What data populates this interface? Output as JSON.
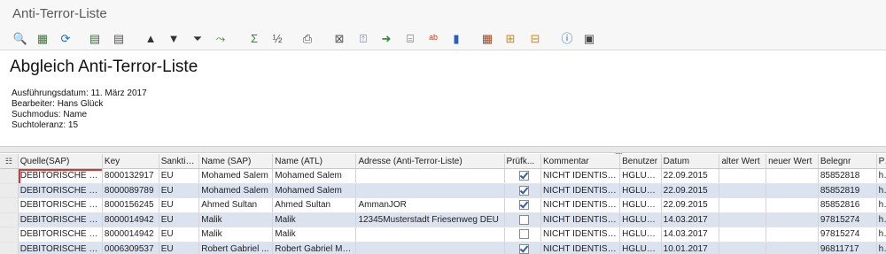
{
  "window": {
    "title": "Anti-Terror-Liste"
  },
  "toolbar": {
    "buttons": [
      {
        "icon": "detail-icon",
        "glyph": "🔍",
        "color": "#2a6e9e"
      },
      {
        "icon": "calculator-icon",
        "glyph": "▦",
        "color": "#3a7a3a"
      },
      {
        "icon": "refresh-icon",
        "glyph": "⟳",
        "color": "#1c6fb3"
      },
      {
        "icon": "select-layout-icon",
        "glyph": "▤",
        "color": "#2b7a2b"
      },
      {
        "icon": "layout-details-icon",
        "glyph": "▤",
        "color": "#555555"
      },
      {
        "icon": "sort-ascending-icon",
        "glyph": "▲",
        "color": "#333333"
      },
      {
        "icon": "sort-descending-icon",
        "glyph": "▼",
        "color": "#333333"
      },
      {
        "icon": "filter-icon",
        "glyph": "⏷",
        "color": "#333333"
      },
      {
        "icon": "delete-filter-icon",
        "glyph": "⤳",
        "color": "#2a7a2a"
      },
      {
        "icon": "sum-icon",
        "glyph": "Σ",
        "color": "#2b8a2b"
      },
      {
        "icon": "subtotal-icon",
        "glyph": "½",
        "color": "#555555"
      },
      {
        "icon": "print-icon",
        "glyph": "⎙",
        "color": "#444444"
      },
      {
        "icon": "view-icon",
        "glyph": "⊠",
        "color": "#555555"
      },
      {
        "icon": "export-icon",
        "glyph": "⍐",
        "color": "#2a5fb3"
      },
      {
        "icon": "send-icon",
        "glyph": "➜",
        "color": "#2b8a2b"
      },
      {
        "icon": "column-icon",
        "glyph": "⌸",
        "color": "#444444"
      },
      {
        "icon": "abc-icon",
        "glyph": "ᵃᵇ",
        "color": "#c04020"
      },
      {
        "icon": "graphic-icon",
        "glyph": "▮",
        "color": "#2a5fb3"
      },
      {
        "icon": "layout-icon",
        "glyph": "▦",
        "color": "#b04010"
      },
      {
        "icon": "choose-layout-icon",
        "glyph": "⊞",
        "color": "#d08a10"
      },
      {
        "icon": "save-layout-icon",
        "glyph": "⊟",
        "color": "#d08a10"
      },
      {
        "icon": "info-icon",
        "glyph": "ⓘ",
        "color": "#2a5fb3"
      },
      {
        "icon": "save-icon",
        "glyph": "▣",
        "color": "#444444"
      }
    ]
  },
  "report": {
    "title": "Abgleich Anti-Terror-Liste",
    "meta": [
      "Ausführungsdatum: 11. März 2017",
      "Bearbeiter: Hans Glück",
      "Suchmodus: Name",
      "Suchtoleranz: 15"
    ]
  },
  "table": {
    "columns": [
      "Quelle(SAP)",
      "Key",
      "Sanktio...",
      "Name (SAP)",
      "Name (ATL)",
      "Adresse (Anti-Terror-Liste)",
      "Prüfk...",
      "Kommentar",
      "Benutzer",
      "Datum",
      "alter Wert",
      "neuer Wert",
      "Belegnr",
      "PDF"
    ],
    "rows": [
      {
        "quelle": "DEBITORISCHE GP",
        "key": "8000132917",
        "sank": "EU",
        "name_sap": "Mohamed Salem",
        "name_atl": "Mohamed Salem",
        "adresse": "",
        "checked": true,
        "kommentar": "NICHT IDENTISCH",
        "benutzer": "HGLUECK",
        "datum": "22.09.2015",
        "alt": "",
        "neu": "",
        "belegnr": "85852818",
        "pdf": "http"
      },
      {
        "quelle": "DEBITORISCHE GP",
        "key": "8000089789",
        "sank": "EU",
        "name_sap": "Mohamed Salem",
        "name_atl": "Mohamed Salem",
        "adresse": "",
        "checked": true,
        "kommentar": "NICHT IDENTISCH",
        "benutzer": "HGLUECK",
        "datum": "22.09.2015",
        "alt": "",
        "neu": "",
        "belegnr": "85852819",
        "pdf": "http"
      },
      {
        "quelle": "DEBITORISCHE GP",
        "key": "8000156245",
        "sank": "EU",
        "name_sap": "Ahmed Sultan",
        "name_atl": "Ahmed Sultan",
        "adresse": "AmmanJOR",
        "checked": true,
        "kommentar": "NICHT IDENTISCH",
        "benutzer": "HGLUECK",
        "datum": "22.09.2015",
        "alt": "",
        "neu": "",
        "belegnr": "85852816",
        "pdf": "http"
      },
      {
        "quelle": "DEBITORISCHE GP",
        "key": "8000014942",
        "sank": "EU",
        "name_sap": "Malik",
        "name_atl": "Malik",
        "adresse": "12345Musterstadt Friesenweg DEU",
        "checked": false,
        "kommentar": "NICHT IDENTISCH",
        "benutzer": "HGLUECK",
        "datum": "14.03.2017",
        "alt": "",
        "neu": "",
        "belegnr": "97815274",
        "pdf": "http"
      },
      {
        "quelle": "DEBITORISCHE GP",
        "key": "8000014942",
        "sank": "EU",
        "name_sap": "Malik",
        "name_atl": "Malik",
        "adresse": "",
        "checked": false,
        "kommentar": "NICHT IDENTISCH",
        "benutzer": "HGLUECK",
        "datum": "14.03.2017",
        "alt": "",
        "neu": "",
        "belegnr": "97815274",
        "pdf": "http"
      },
      {
        "quelle": "DEBITORISCHE GP",
        "key": "0006309537",
        "sank": "EU",
        "name_sap": "Robert Gabriel ...",
        "name_atl": "Robert Gabriel Mu...",
        "adresse": "",
        "checked": true,
        "kommentar": "NICHT IDENTISCH",
        "benutzer": "HGLUECK",
        "datum": "10.01.2017",
        "alt": "",
        "neu": "",
        "belegnr": "96811717",
        "pdf": "http"
      }
    ]
  }
}
